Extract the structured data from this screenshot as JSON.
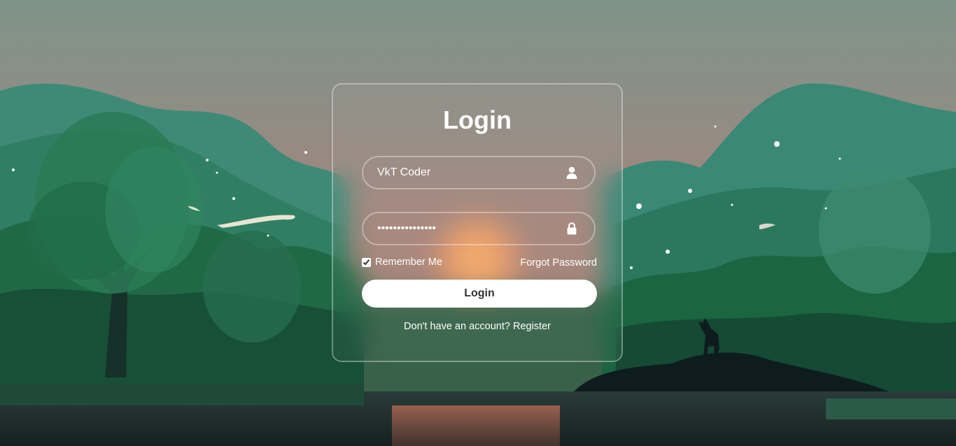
{
  "login": {
    "title": "Login",
    "username_value": "VkT Coder",
    "password_value": "•••••••••••••••",
    "remember_label": "Remember Me",
    "remember_checked": true,
    "forgot_label": "Forgot Password",
    "button_label": "Login",
    "register_prompt": "Don't have an account?",
    "register_link": "Register"
  },
  "icons": {
    "username": "user-icon",
    "password": "lock-icon"
  },
  "colors": {
    "text": "#ffffff",
    "button_bg": "#ffffff",
    "button_text": "#333333"
  }
}
